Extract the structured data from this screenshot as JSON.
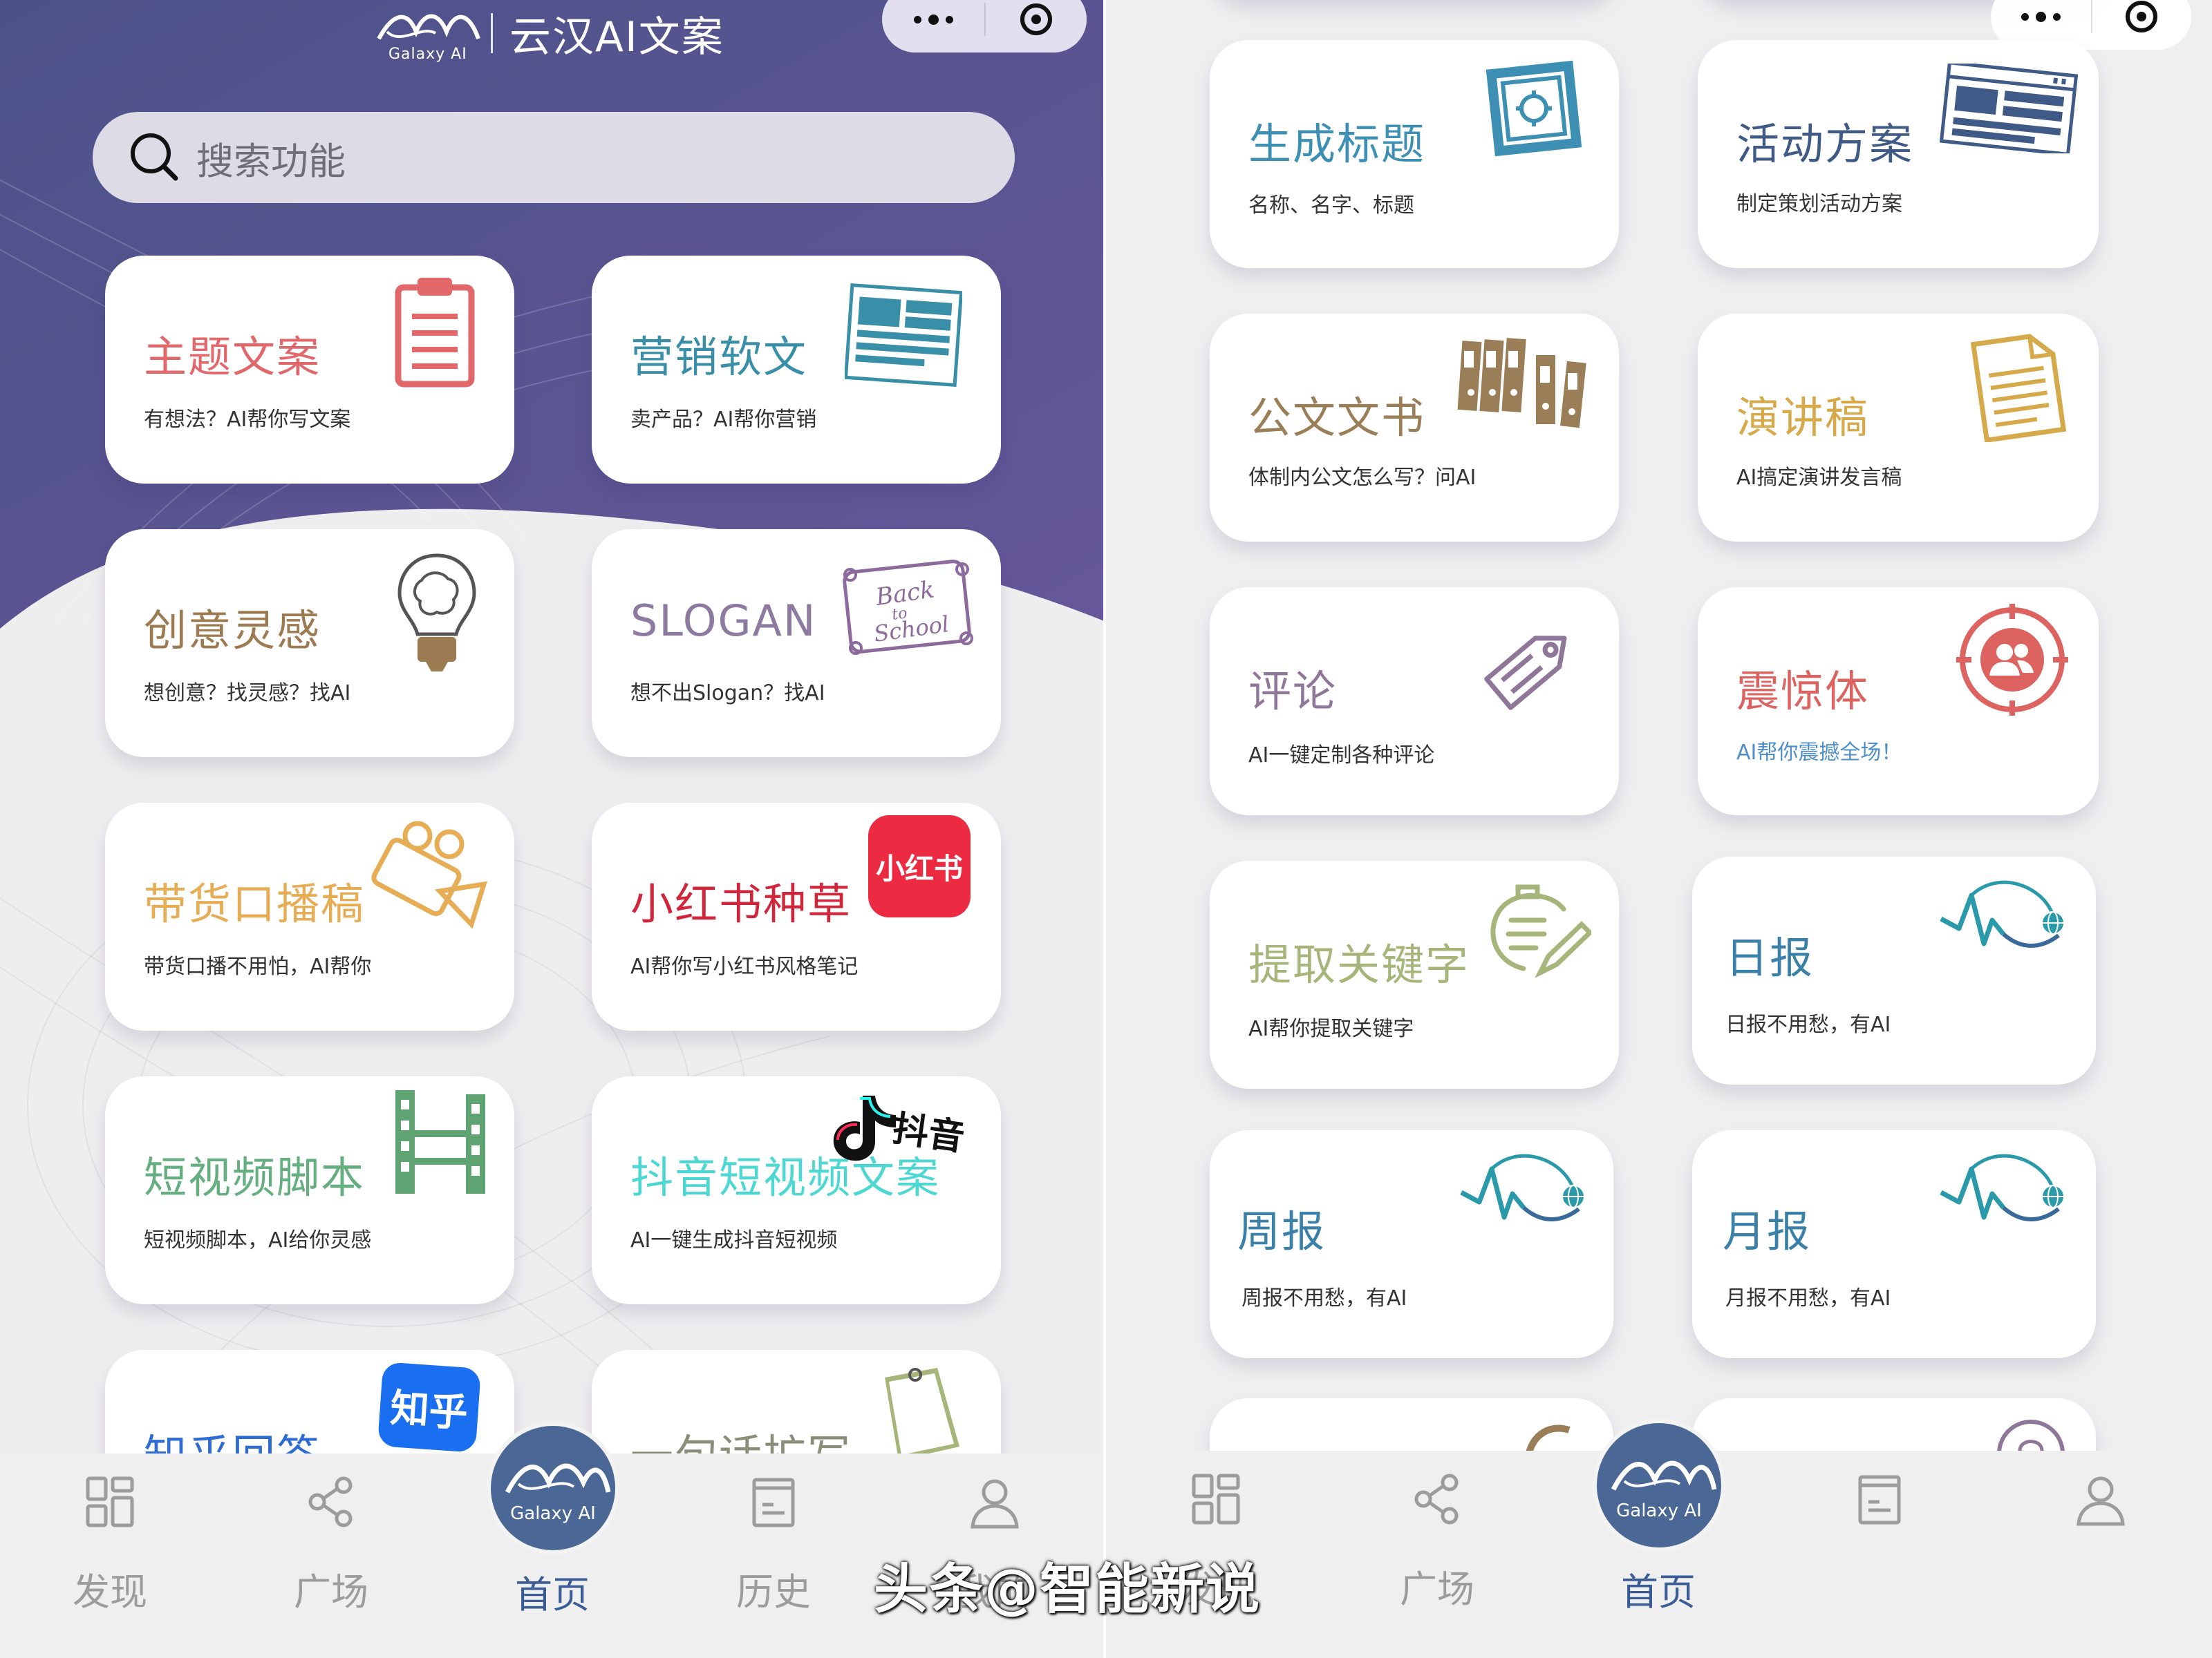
{
  "left_screen": {
    "brand": {
      "logo_text": "Galaxy AI",
      "title": "云汉AI文案"
    },
    "search": {
      "placeholder": "搜索功能"
    },
    "cards": [
      {
        "title": "主题文案",
        "subtitle": "有想法？AI帮你写文案",
        "title_color": "#e2676a",
        "icon": "clipboard-icon"
      },
      {
        "title": "营销软文",
        "subtitle": "卖产品？AI帮你营销",
        "title_color": "#3a8fa8",
        "icon": "newspaper-icon"
      },
      {
        "title": "创意灵感",
        "subtitle": "想创意？找灵感？找AI",
        "title_color": "#9c7a52",
        "icon": "lightbulb-brain-icon"
      },
      {
        "title": "SLOGAN",
        "subtitle": "想不出Slogan？找AI",
        "title_color": "#8d7aa0",
        "icon": "back-to-school-icon",
        "icon_text": "Back to School"
      },
      {
        "title": "带货口播稿",
        "subtitle": "带货口播不用怕，AI帮你",
        "title_color": "#e6ad55",
        "icon": "video-camera-icon"
      },
      {
        "title": "小红书种草",
        "subtitle": "AI帮你写小红书风格笔记",
        "title_color": "#d0263b",
        "icon": "xiaohongshu-icon",
        "icon_text": "小红书"
      },
      {
        "title": "短视频脚本",
        "subtitle": "短视频脚本，AI给你灵感",
        "title_color": "#64ae80",
        "icon": "film-strip-icon"
      },
      {
        "title": "抖音短视频文案",
        "subtitle": "AI一键生成抖音短视频",
        "title_color": "#4dd7d3",
        "icon": "douyin-icon",
        "icon_text": "抖音"
      },
      {
        "title": "知乎回答",
        "subtitle": "",
        "title_color": "#2e6bd3",
        "icon": "zhihu-icon",
        "icon_text": "知乎"
      },
      {
        "title": "一句话扩写",
        "subtitle": "",
        "title_color": "#8a8d78",
        "icon": "notebook-icon"
      }
    ]
  },
  "right_screen": {
    "cards": [
      {
        "title": "生成标题",
        "subtitle": "名称、名字、标题",
        "title_color": "#3d8fb3",
        "icon": "safe-icon"
      },
      {
        "title": "活动方案",
        "subtitle": "制定策划活动方案",
        "title_color": "#3f5a86",
        "icon": "browser-layout-icon"
      },
      {
        "title": "公文文书",
        "subtitle": "体制内公文怎么写？问AI",
        "title_color": "#9a7e58",
        "icon": "binders-icon"
      },
      {
        "title": "演讲稿",
        "subtitle": "AI搞定演讲发言稿",
        "title_color": "#d6a94a",
        "icon": "document-icon"
      },
      {
        "title": "评论",
        "subtitle": "AI一键定制各种评论",
        "title_color": "#8f7799",
        "icon": "tag-icon"
      },
      {
        "title": "震惊体",
        "subtitle": "AI帮你震撼全场！",
        "title_color": "#dd6360",
        "subtitle_color": "#4e8fc9",
        "icon": "people-target-icon"
      },
      {
        "title": "提取关键字",
        "subtitle": "AI帮你提取关键字",
        "title_color": "#a6b57a",
        "icon": "notes-pencil-icon"
      },
      {
        "title": "日报",
        "subtitle": "日报不用愁，有AI",
        "title_color": "#3a80a8",
        "icon": "pulse-globe-icon"
      },
      {
        "title": "周报",
        "subtitle": "周报不用愁，有AI",
        "title_color": "#3a80a8",
        "icon": "pulse-globe-icon"
      },
      {
        "title": "月报",
        "subtitle": "月报不用愁，有AI",
        "title_color": "#3a80a8",
        "icon": "pulse-globe-icon"
      }
    ]
  },
  "tabbar": {
    "items": [
      {
        "label": "发现",
        "icon": "grid-icon"
      },
      {
        "label": "广场",
        "icon": "share-icon"
      },
      {
        "label": "首页",
        "icon": "galaxy-ai-logo-icon",
        "active": true
      },
      {
        "label": "历史",
        "icon": "history-doc-icon"
      },
      {
        "label": "我的",
        "icon": "user-icon"
      }
    ],
    "home_logo_text": "Galaxy AI"
  },
  "watermark": "头条@智能新说"
}
